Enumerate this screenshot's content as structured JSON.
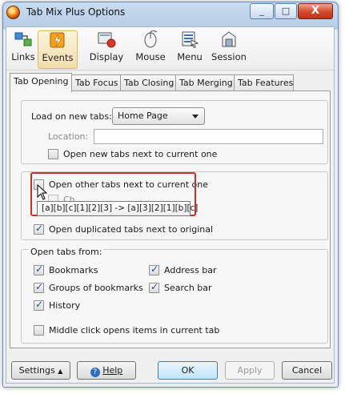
{
  "window": {
    "title": "Tab Mix Plus Options",
    "close_glyph": "X",
    "minimize_glyph": "_",
    "maximize_glyph": "□"
  },
  "toolbar": {
    "items": [
      {
        "label": "Links",
        "icon": "links-icon"
      },
      {
        "label": "Events",
        "icon": "events-icon",
        "active": true
      },
      {
        "label": "Display",
        "icon": "display-icon"
      },
      {
        "label": "Mouse",
        "icon": "mouse-icon"
      },
      {
        "label": "Menu",
        "icon": "menu-icon"
      },
      {
        "label": "Session",
        "icon": "session-icon"
      }
    ]
  },
  "tabs": [
    "Tab Opening",
    "Tab Focus",
    "Tab Closing",
    "Tab Merging",
    "Tab Features"
  ],
  "active_tab": "Tab Opening",
  "load_new_tabs": {
    "label": "Load on new tabs:",
    "selected": "Home Page",
    "location_label": "Location:",
    "location_value": "",
    "open_next_label": "Open new tabs next to current one",
    "open_next_checked": false
  },
  "other_tabs": {
    "open_other_label": "Open other tabs next to current one",
    "open_other_checked": false,
    "sub_label_partial": "Ch",
    "tooltip": "[a][b][c][1][2][3] -> [a][3][2][1][b][c]",
    "open_duplicated_label": "Open duplicated tabs next to original",
    "open_duplicated_checked": true
  },
  "open_tabs_from": {
    "heading": "Open tabs from:",
    "bookmarks": "Bookmarks",
    "groups": "Groups of bookmarks",
    "history": "History",
    "address_bar": "Address bar",
    "search_bar": "Search bar",
    "middle_click": "Middle click opens items in current tab",
    "middle_click_checked": false
  },
  "buttons": {
    "settings": "Settings",
    "settings_arrow": "▲",
    "help": "Help",
    "ok": "OK",
    "apply": "Apply",
    "cancel": "Cancel"
  },
  "colors": {
    "highlight": "#c8302a",
    "close": "#c13318",
    "check": "#1d4e9c"
  }
}
